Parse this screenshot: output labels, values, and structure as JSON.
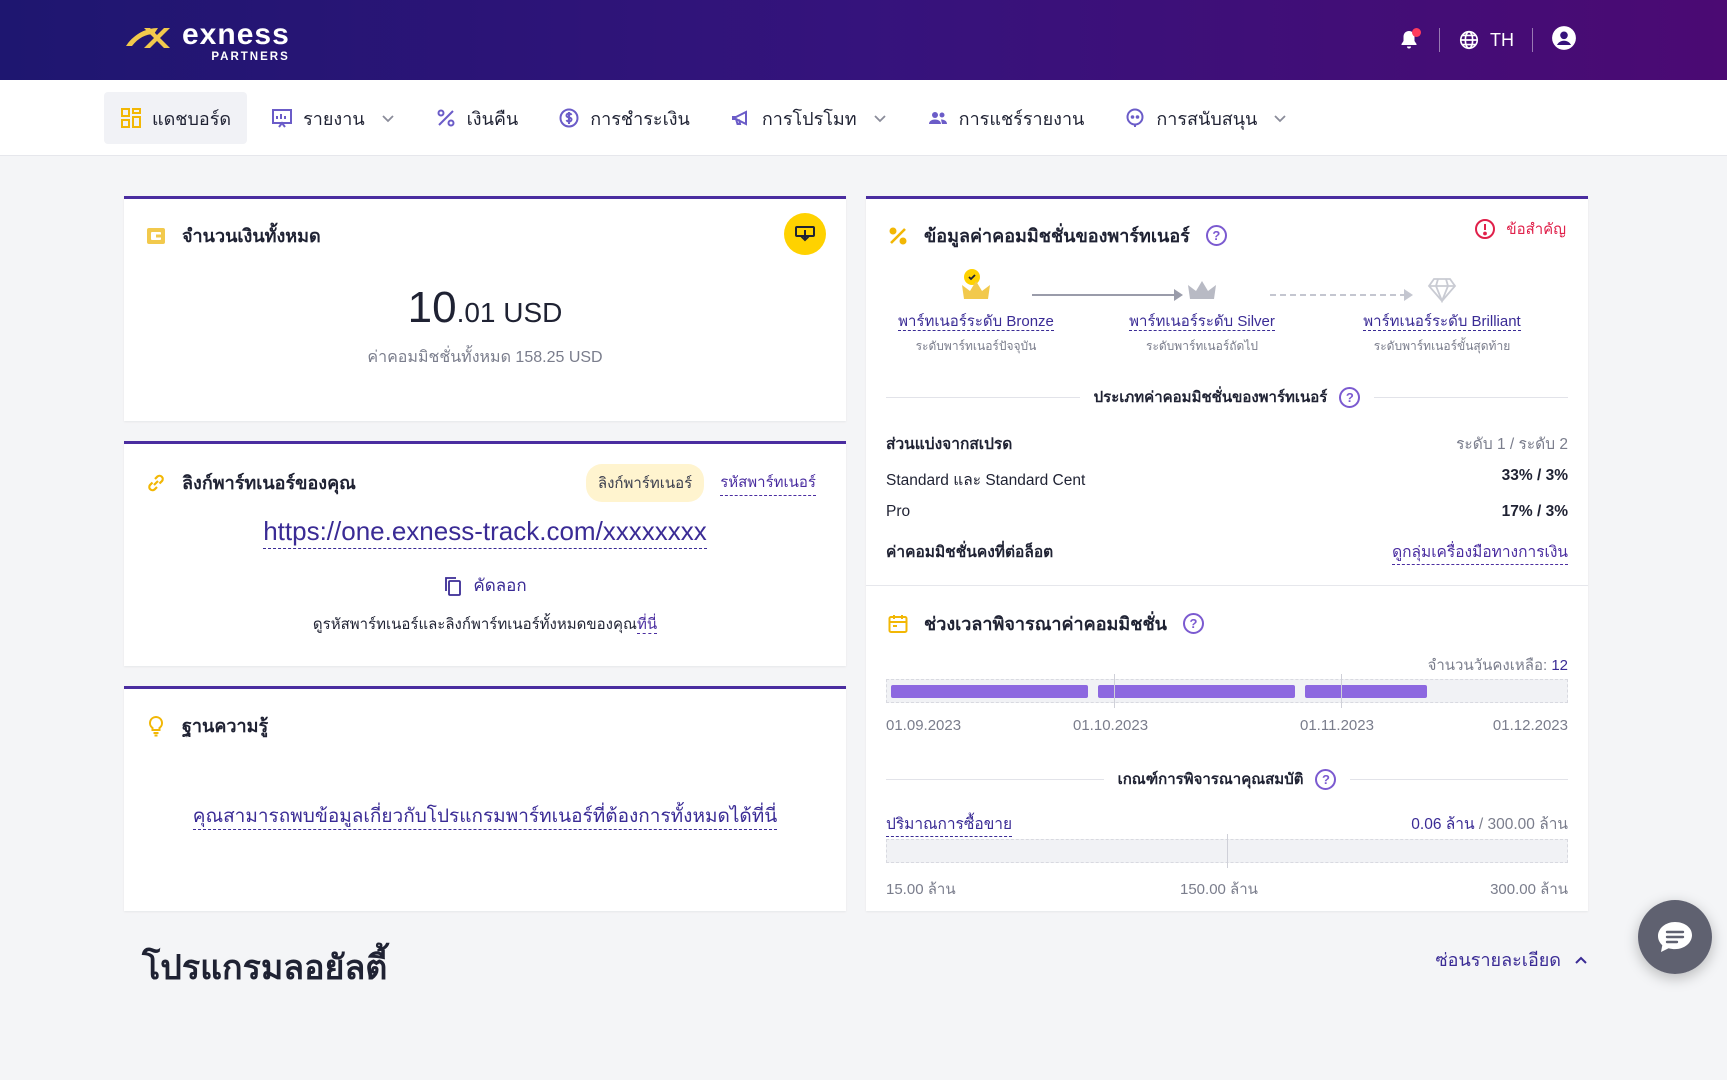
{
  "header": {
    "brand": "exness",
    "brand_sub": "PARTNERS",
    "language": "TH",
    "icons": [
      "bell-icon",
      "globe-icon",
      "user-icon"
    ],
    "colors": {
      "gradient_start": "#1e1670",
      "gradient_end": "#4b0a73",
      "notification_dot": "#ff3b5c"
    }
  },
  "nav": {
    "items": [
      {
        "label": "แดชบอร์ด",
        "icon": "dashboard-icon",
        "active": true,
        "dropdown": false
      },
      {
        "label": "รายงาน",
        "icon": "report-icon",
        "active": false,
        "dropdown": true
      },
      {
        "label": "เงินคืน",
        "icon": "percent-icon",
        "active": false,
        "dropdown": false
      },
      {
        "label": "การชำระเงิน",
        "icon": "dollar-coin-icon",
        "active": false,
        "dropdown": false
      },
      {
        "label": "การโปรโมท",
        "icon": "megaphone-icon",
        "active": false,
        "dropdown": true
      },
      {
        "label": "การแชร์รายงาน",
        "icon": "users-icon",
        "active": false,
        "dropdown": false
      },
      {
        "label": "การสนับสนุน",
        "icon": "support-icon",
        "active": false,
        "dropdown": true
      }
    ]
  },
  "balance": {
    "title": "จำนวนเงินทั้งหมด",
    "amount_main": "10",
    "amount_decimal": ".01 USD",
    "total_commission": "ค่าคอมมิชชั่นทั้งหมด 158.25 USD"
  },
  "partner_link": {
    "title": "ลิงก์พาร์ทเนอร์ของคุณ",
    "tab_link": "ลิงก์พาร์ทเนอร์",
    "tab_code": "รหัสพาร์ทเนอร์",
    "url": "https://one.exness-track.com/xxxxxxxx",
    "copy_label": "คัดลอก",
    "note": "ดูรหัสพาร์ทเนอร์และลิงก์พาร์ทเนอร์ทั้งหมดของคุณ",
    "note_link": "ที่นี่"
  },
  "knowledge": {
    "title": "ฐานความรู้",
    "link": "คุณสามารถพบข้อมูลเกี่ยวกับโปรแกรมพาร์ทเนอร์ที่ต้องการทั้งหมดได้ที่นี่"
  },
  "commission": {
    "title": "ข้อมูลค่าคอมมิชชั่นของพาร์ทเนอร์",
    "important": "ข้อสำคัญ",
    "tiers": [
      {
        "name": "พาร์ทเนอร์ระดับ Bronze",
        "sub": "ระดับพาร์ทเนอร์ปัจจุบัน",
        "icon": "crown-icon",
        "color": "#f2c94c"
      },
      {
        "name": "พาร์ทเนอร์ระดับ Silver",
        "sub": "ระดับพาร์ทเนอร์ถัดไป",
        "icon": "crown-icon",
        "color": "#b8bac4"
      },
      {
        "name": "พาร์ทเนอร์ระดับ Brilliant",
        "sub": "ระดับพาร์ทเนอร์ขั้นสุดท้าย",
        "icon": "diamond-icon",
        "color": "#c9cbd3"
      }
    ],
    "types_title": "ประเภทค่าคอมมิชชั่นของพาร์ทเนอร์",
    "rows": [
      {
        "label": "ส่วนแบ่งจากสเปรด",
        "value": "ระดับ 1 / ระดับ 2"
      },
      {
        "label": "Standard และ Standard Cent",
        "value": "33% / 3%"
      },
      {
        "label": "Pro",
        "value": "17% / 3%"
      },
      {
        "label": "ค่าคอมมิชชั่นคงที่ต่อล็อต",
        "value": "ดูกลุ่มเครื่องมือทางการเงิน"
      }
    ],
    "period_title": "ช่วงเวลาพิจารณาค่าคอมมิชชั่น",
    "days_left_label": "จำนวนวันคงเหลือ:",
    "days_left_value": "12",
    "period_progress": [
      1.0,
      1.0,
      0.62
    ],
    "dates": [
      "01.09.2023",
      "01.10.2023",
      "01.11.2023",
      "01.12.2023"
    ],
    "criteria_title": "เกณฑ์การพิจารณาคุณสมบัติ",
    "volume_label": "ปริมาณการซื้อขาย",
    "volume_current": "0.06 ล้าน",
    "volume_target": "/ 300.00 ล้าน",
    "volume_ticks": [
      "15.00 ล้าน",
      "150.00 ล้าน",
      "300.00 ล้าน"
    ]
  },
  "loyalty": {
    "title": "โปรแกรมลอยัลตี้",
    "hide_details": "ซ่อนรายละเอียด"
  },
  "accent": "#4a2da0"
}
